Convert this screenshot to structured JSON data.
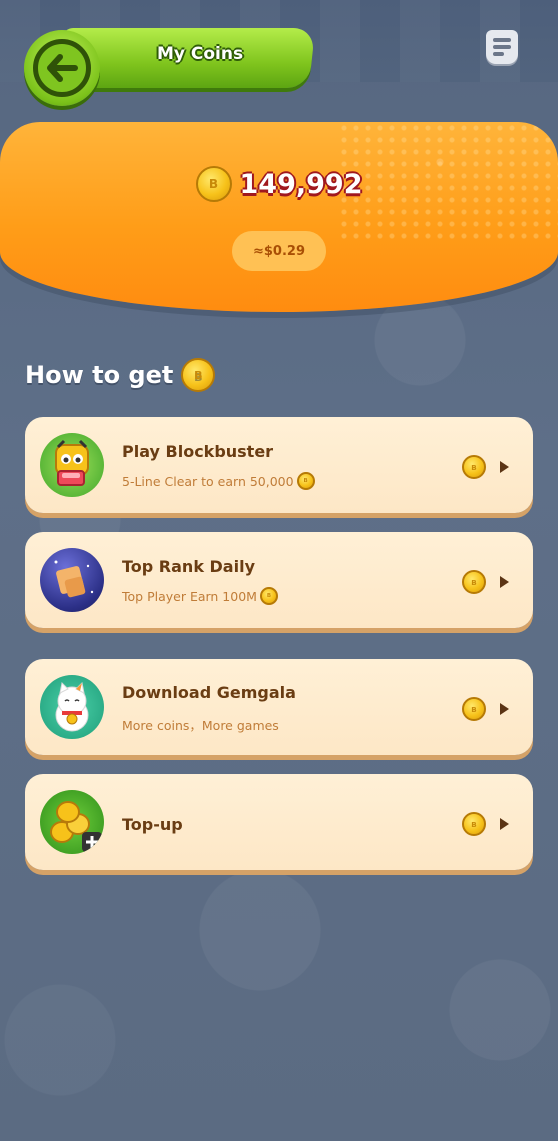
{
  "header": {
    "title": "My Coins",
    "back_icon": "arrow-left-icon",
    "menu_icon": "document-icon"
  },
  "balance": {
    "coins": "149,992",
    "usd_equivalent": "≈$0.29"
  },
  "how_to_get": {
    "title": "How to get"
  },
  "items": [
    {
      "title": "Play Blockbuster",
      "subtitle": "5-Line Clear to earn 50,000",
      "icon": "blockbuster-game-icon"
    },
    {
      "title": "Top Rank Daily",
      "subtitle": "Top Player Earn 100M",
      "icon": "top-rank-icon"
    },
    {
      "title": "Download Gemgala",
      "subtitle": "More coins，More games",
      "icon": "lucky-cat-icon"
    },
    {
      "title": "Top-up",
      "subtitle": "",
      "icon": "coins-topup-icon"
    }
  ],
  "colors": {
    "accent_orange": "#ff9d18",
    "header_green": "#7fc41d",
    "card_bg": "#fff0d6",
    "text_brown": "#6a3d13"
  }
}
